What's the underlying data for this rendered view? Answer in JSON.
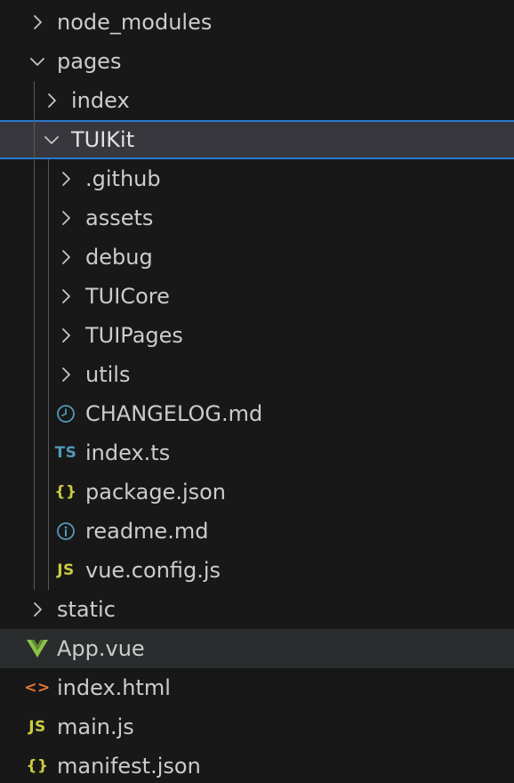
{
  "explorer": {
    "items": [
      {
        "label": "node_modules",
        "kind": "folder",
        "expanded": false,
        "depth": 0,
        "icon": "chevron-right-icon"
      },
      {
        "label": "pages",
        "kind": "folder",
        "expanded": true,
        "depth": 0,
        "icon": "chevron-down-icon"
      },
      {
        "label": "index",
        "kind": "folder",
        "expanded": false,
        "depth": 1,
        "icon": "chevron-right-icon"
      },
      {
        "label": "TUIKit",
        "kind": "folder",
        "expanded": true,
        "depth": 1,
        "icon": "chevron-down-icon",
        "selected": true
      },
      {
        "label": ".github",
        "kind": "folder",
        "expanded": false,
        "depth": 2,
        "icon": "chevron-right-icon"
      },
      {
        "label": "assets",
        "kind": "folder",
        "expanded": false,
        "depth": 2,
        "icon": "chevron-right-icon"
      },
      {
        "label": "debug",
        "kind": "folder",
        "expanded": false,
        "depth": 2,
        "icon": "chevron-right-icon"
      },
      {
        "label": "TUICore",
        "kind": "folder",
        "expanded": false,
        "depth": 2,
        "icon": "chevron-right-icon"
      },
      {
        "label": "TUIPages",
        "kind": "folder",
        "expanded": false,
        "depth": 2,
        "icon": "chevron-right-icon"
      },
      {
        "label": "utils",
        "kind": "folder",
        "expanded": false,
        "depth": 2,
        "icon": "chevron-right-icon"
      },
      {
        "label": "CHANGELOG.md",
        "kind": "file",
        "depth": 2,
        "icon": "clock-icon",
        "icon_color": "#519aba"
      },
      {
        "label": "index.ts",
        "kind": "file",
        "depth": 2,
        "icon": "typescript-icon",
        "icon_text": "TS",
        "icon_color": "#519aba"
      },
      {
        "label": "package.json",
        "kind": "file",
        "depth": 2,
        "icon": "json-braces-icon",
        "icon_text": "{}",
        "icon_color": "#cbcb41"
      },
      {
        "label": "readme.md",
        "kind": "file",
        "depth": 2,
        "icon": "info-icon",
        "icon_color": "#519aba"
      },
      {
        "label": "vue.config.js",
        "kind": "file",
        "depth": 2,
        "icon": "javascript-icon",
        "icon_text": "JS",
        "icon_color": "#cbcb41"
      },
      {
        "label": "static",
        "kind": "folder",
        "expanded": false,
        "depth": 0,
        "icon": "chevron-right-icon"
      },
      {
        "label": "App.vue",
        "kind": "file",
        "depth": 0,
        "icon": "vue-icon",
        "icon_color": "#8dc149",
        "hovered": true
      },
      {
        "label": "index.html",
        "kind": "file",
        "depth": 0,
        "icon": "html-icon",
        "icon_text": "<>",
        "icon_color": "#e37933"
      },
      {
        "label": "main.js",
        "kind": "file",
        "depth": 0,
        "icon": "javascript-icon",
        "icon_text": "JS",
        "icon_color": "#cbcb41"
      },
      {
        "label": "manifest.json",
        "kind": "file",
        "depth": 0,
        "icon": "json-braces-icon",
        "icon_text": "{}",
        "icon_color": "#cbcb41"
      }
    ]
  },
  "colors": {
    "background": "#181818",
    "text": "#cccccc",
    "chevron": "#c5c5c5",
    "selection_border": "#2b79d0",
    "selection_background": "#37373d",
    "hover_background": "#2a2d2e",
    "indent_guide": "#585858"
  }
}
